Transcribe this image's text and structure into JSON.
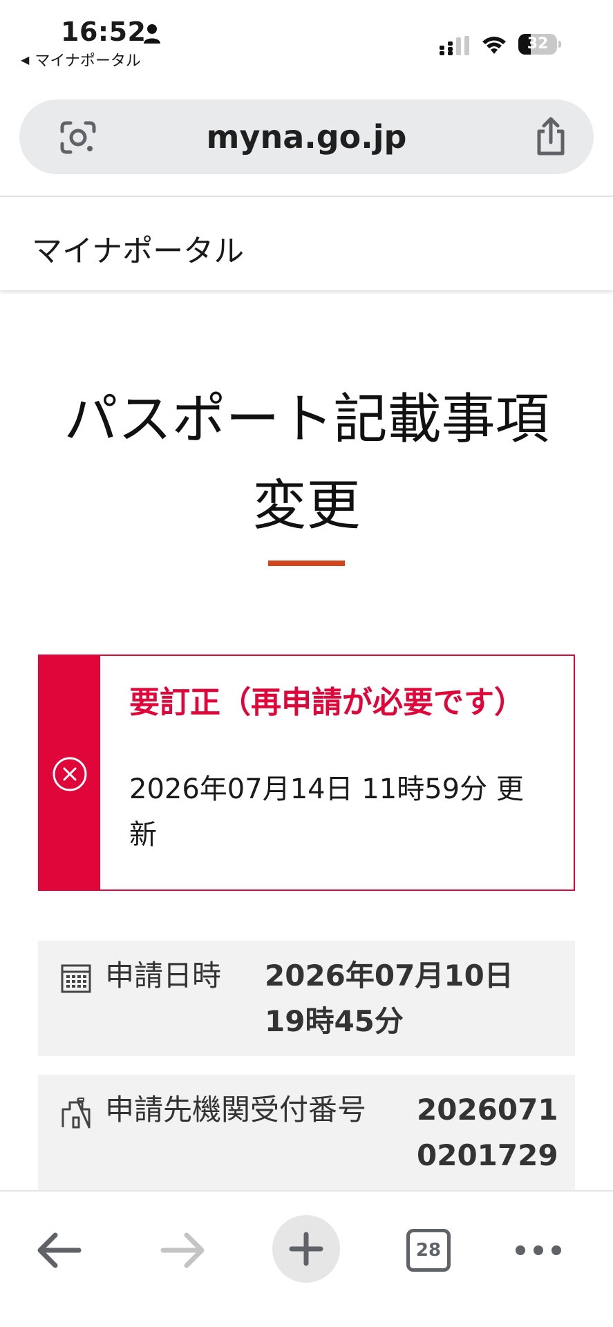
{
  "status_bar": {
    "time": "16:52",
    "back_app_label": "マイナポータル",
    "battery_level": "32",
    "icons": [
      "person-icon",
      "cellular-signal-icon",
      "wifi-icon",
      "battery-icon"
    ]
  },
  "browser": {
    "url": "myna.go.jp",
    "tabs_count": "28",
    "icons": [
      "google-lens-icon",
      "share-icon",
      "back-arrow-icon",
      "forward-arrow-icon",
      "new-tab-plus-icon",
      "tabs-icon",
      "more-icon"
    ]
  },
  "site": {
    "title": "マイナポータル"
  },
  "page": {
    "title_line1": "パスポート記載事項",
    "title_line2": "変更"
  },
  "alert": {
    "title": "要訂正（再申請が必要です）",
    "updated": "2026年07月14日 11時59分 更新",
    "icon": "error-circle-x-icon",
    "color": "#e0063a"
  },
  "info": {
    "application_datetime": {
      "label": "申請日時",
      "value": "2026年07月10日 19時45分",
      "icon": "calendar-icon"
    },
    "receipt_number": {
      "label": "申請先機関受付番号",
      "value": "20260710201729",
      "icon": "building-icon"
    }
  },
  "colors": {
    "accent_red": "#e0063a",
    "title_underline": "#d2461e",
    "row_background": "#f2f2f2"
  }
}
